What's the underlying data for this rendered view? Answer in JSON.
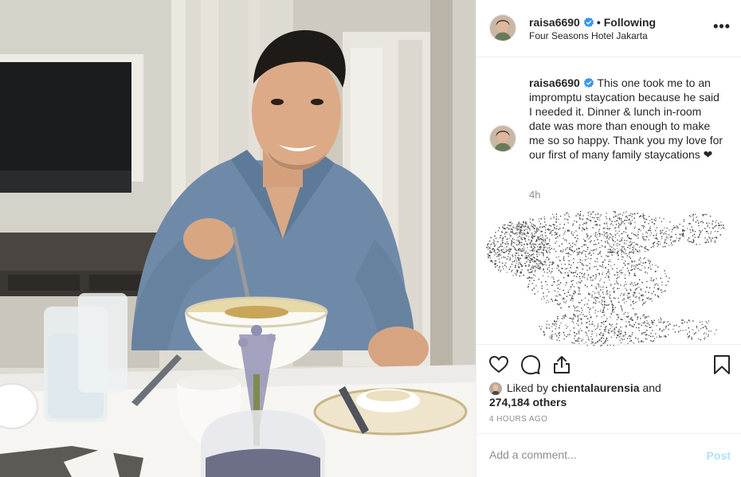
{
  "post": {
    "author": {
      "username": "raisa6690",
      "verified": true,
      "following_label": "Following",
      "location": "Four Seasons Hotel Jakarta"
    },
    "more_icon": "more-horizontal-icon",
    "caption": {
      "username": "raisa6690",
      "text": "This one took me to an impromptu staycation because he said I needed it. Dinner & lunch in-room date was more than enough to make me so so happy. Thank you my love for our first of many family staycations ❤",
      "relative_time": "4h"
    },
    "actions": {
      "icons": [
        "heart-icon",
        "comment-icon",
        "share-icon",
        "bookmark-icon"
      ]
    },
    "likes": {
      "liked_by_prefix": "Liked by",
      "liked_by_user": "chientalaurensia",
      "and_word": "and",
      "count_text": "274,184 others"
    },
    "timestamp": "4 HOURS AGO",
    "comment": {
      "placeholder": "Add a comment...",
      "post_label": "Post"
    }
  },
  "colors": {
    "verified_blue": "#3897f0",
    "muted_text": "#8e8e8e",
    "post_button_disabled": "#b2dffc",
    "border": "#efefef"
  }
}
